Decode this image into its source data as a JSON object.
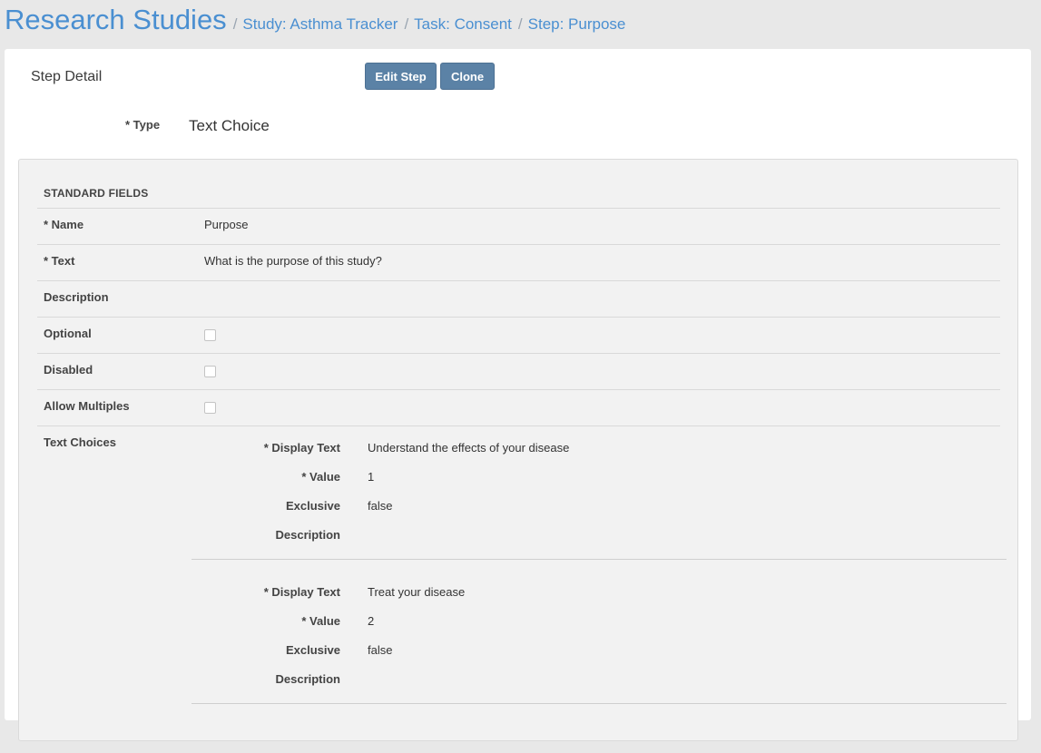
{
  "header": {
    "app_title": "Research Studies",
    "breadcrumbs": [
      {
        "label": "Study: Asthma Tracker"
      },
      {
        "label": "Task: Consent"
      },
      {
        "label": "Step: Purpose"
      }
    ],
    "separator": "/"
  },
  "panel": {
    "title": "Step Detail",
    "buttons": {
      "edit": "Edit Step",
      "clone": "Clone"
    },
    "type_label": "* Type",
    "type_value": "Text Choice"
  },
  "standard_fields": {
    "heading": "STANDARD FIELDS",
    "rows": [
      {
        "label": "* Name",
        "value": "Purpose"
      },
      {
        "label": "* Text",
        "value": "What is the purpose of this study?"
      },
      {
        "label": "Description",
        "value": ""
      },
      {
        "label": "Optional",
        "checked": false
      },
      {
        "label": "Disabled",
        "checked": false
      },
      {
        "label": "Allow Multiples",
        "checked": false
      },
      {
        "label": "Text Choices"
      }
    ]
  },
  "text_choices": {
    "labels": {
      "display_text": "* Display Text",
      "value": "* Value",
      "exclusive": "Exclusive",
      "description": "Description"
    },
    "items": [
      {
        "display_text": "Understand the effects of your disease",
        "value": "1",
        "exclusive": "false",
        "description": ""
      },
      {
        "display_text": "Treat your disease",
        "value": "2",
        "exclusive": "false",
        "description": ""
      }
    ]
  },
  "colors": {
    "link": "#4a8fd1",
    "button": "#5b82a6",
    "background": "#e8e8e8",
    "panel": "#ffffff",
    "fields_box": "#f2f2f2"
  }
}
